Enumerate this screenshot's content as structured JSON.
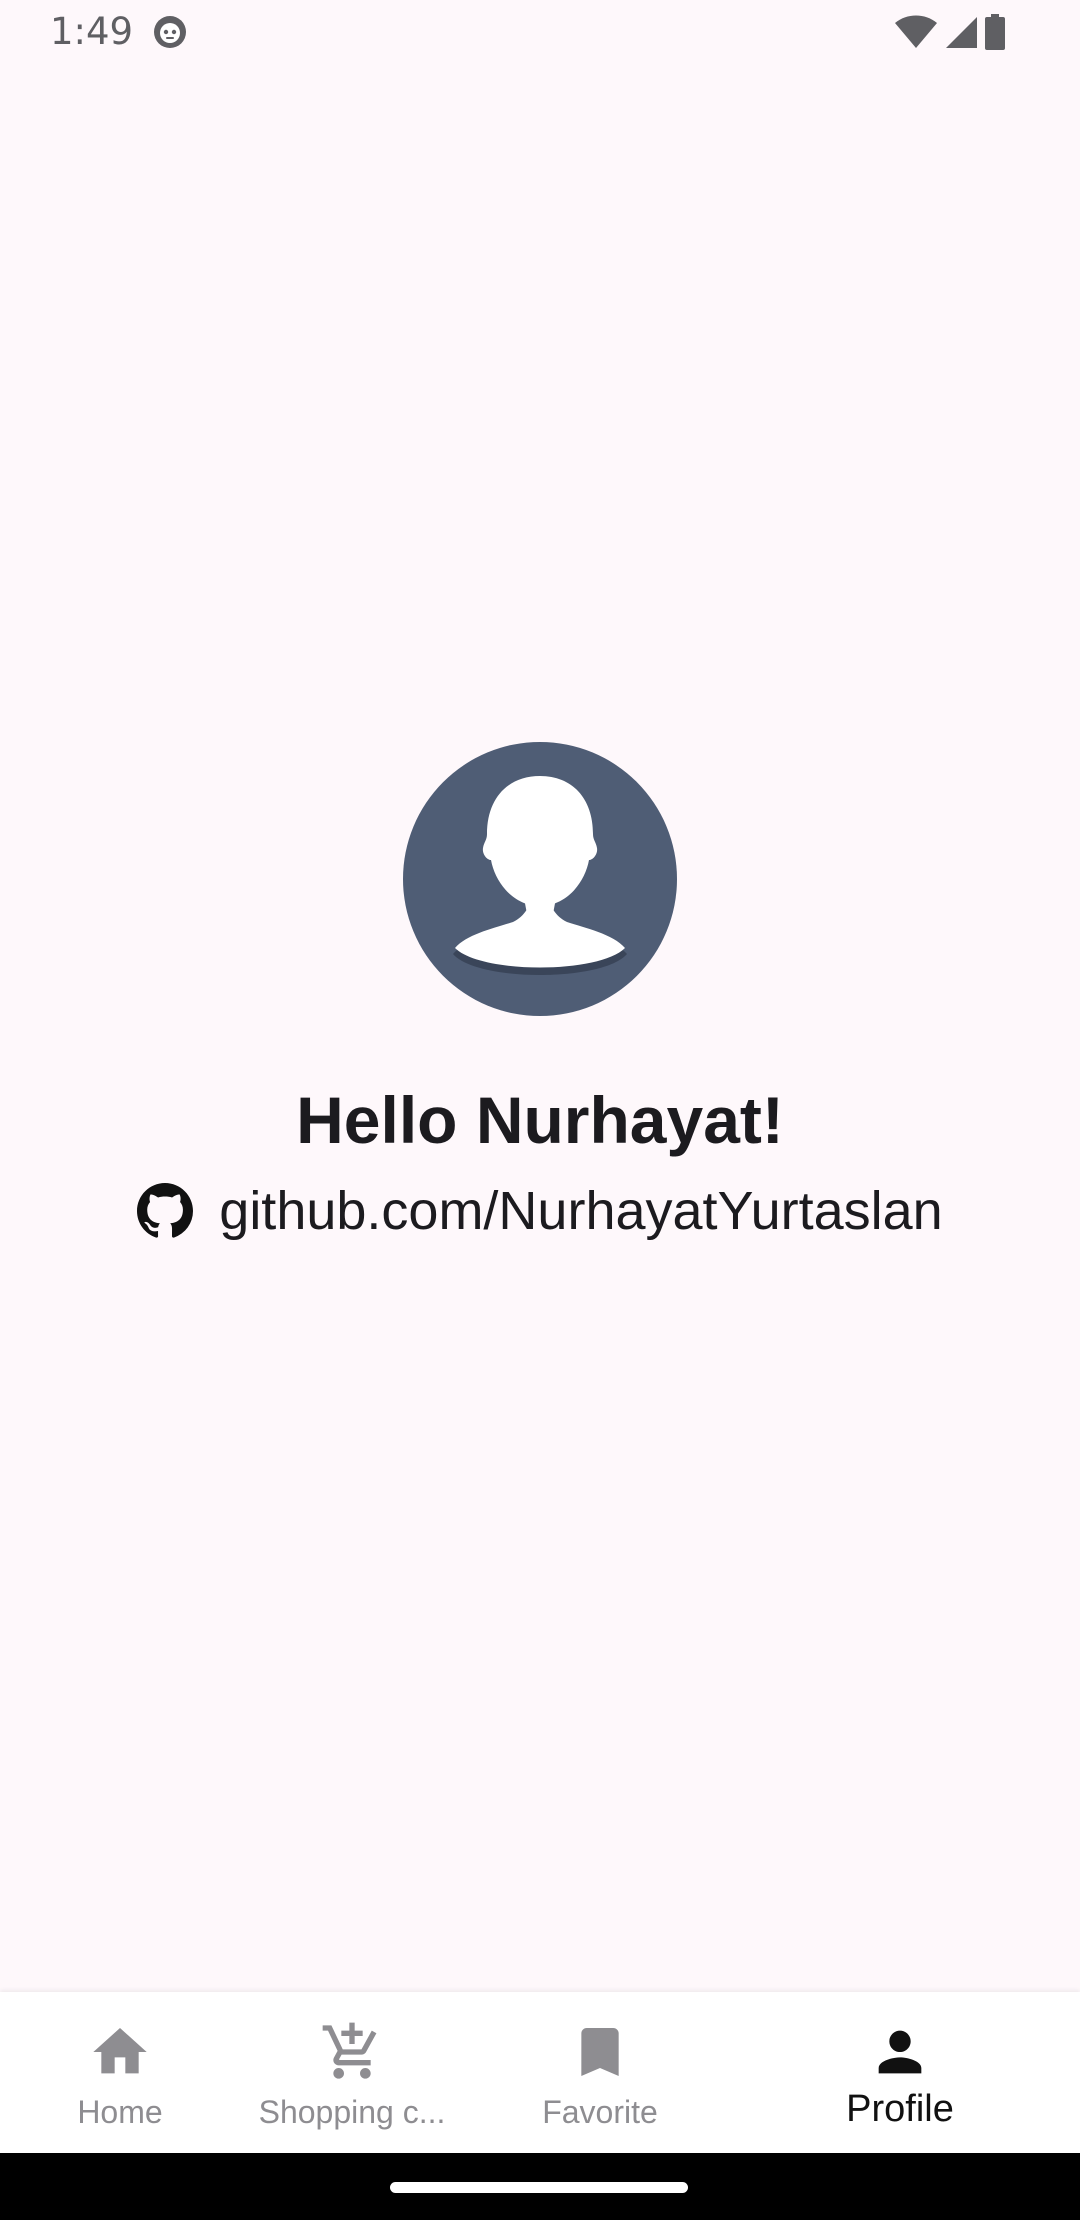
{
  "status_bar": {
    "time": "1:49",
    "icons": [
      "app-notification-icon",
      "wifi-icon",
      "cellular-signal-icon",
      "battery-icon"
    ]
  },
  "profile": {
    "avatar_icon": "default-avatar-icon",
    "avatar_bg_color": "#4F5D75",
    "greeting": "Hello Nurhayat!",
    "github_icon": "github-icon",
    "github_link": "github.com/NurhayatYurtaslan"
  },
  "bottom_nav": {
    "active_tab": "Profile",
    "items": [
      {
        "label": "Home",
        "icon": "home-icon"
      },
      {
        "label": "Shopping c...",
        "icon": "add-to-cart-icon"
      },
      {
        "label": "Favorite",
        "icon": "bookmark-icon"
      },
      {
        "label": "Profile",
        "icon": "person-icon"
      }
    ]
  },
  "colors": {
    "background": "#FEF8FB",
    "nav_inactive": "#8E8D91",
    "nav_active": "#111111"
  }
}
